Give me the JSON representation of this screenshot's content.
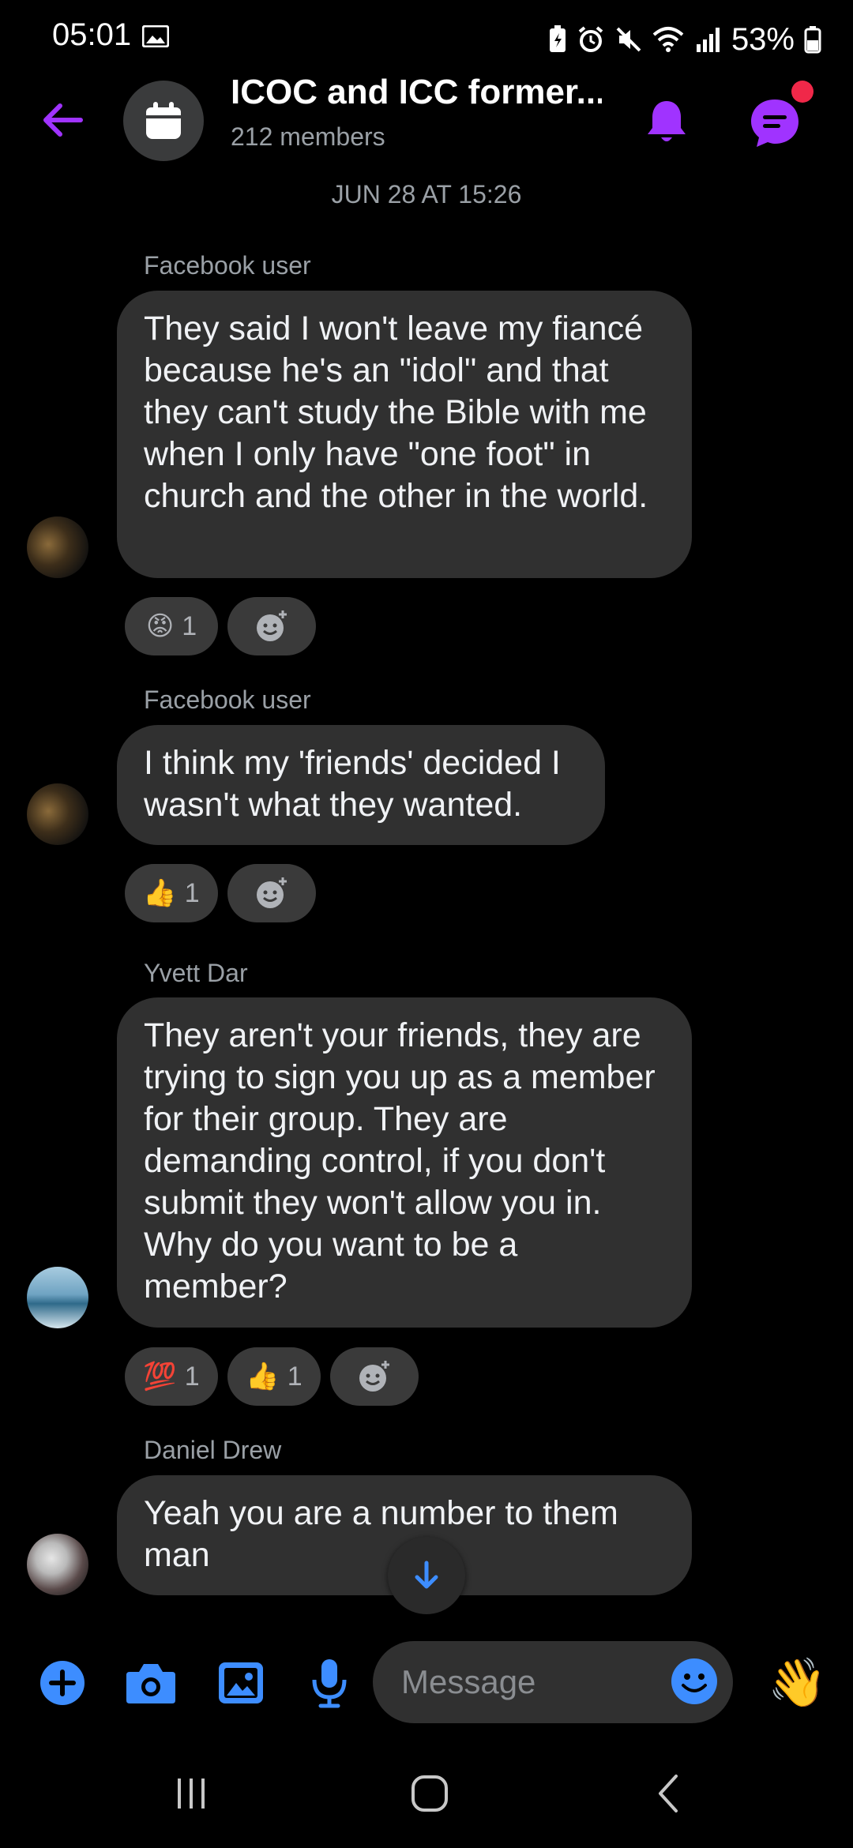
{
  "status_bar": {
    "time": "05:01",
    "battery": "53%"
  },
  "header": {
    "title": "ICOC and ICC former...",
    "subtitle": "212 members"
  },
  "date_separator": "JUN 28 AT 15:26",
  "messages": [
    {
      "sender": "Facebook user",
      "text": "They said I won't leave my fiancé because he's an \"idol\" and that they can't study the Bible with me when I only have \"one foot\" in church and the other in the world.",
      "reactions": [
        {
          "emoji": "😡",
          "count": "1"
        }
      ]
    },
    {
      "sender": "Facebook user",
      "text": "I think my 'friends' decided I wasn't what they wanted.",
      "reactions": [
        {
          "emoji": "👍",
          "count": "1"
        }
      ]
    },
    {
      "sender": "Yvett Dar",
      "text": "They aren't your friends, they are trying to sign you up as a member for their group. They are demanding control, if you don't submit they won't allow you in. Why do you want to be a member?",
      "reactions": [
        {
          "emoji": "💯",
          "count": "1"
        },
        {
          "emoji": "👍",
          "count": "1"
        }
      ]
    },
    {
      "sender": "Daniel Drew",
      "text": "Yeah you are a number to them man",
      "reactions": []
    }
  ],
  "composer": {
    "placeholder": "Message",
    "wave_emoji": "👋"
  },
  "colors": {
    "accent_purple": "#a033ff",
    "accent_blue": "#3d8dff",
    "bubble_bg": "#303030",
    "notification_dot": "#f02849"
  },
  "icons": [
    "back-arrow-icon",
    "calendar-icon",
    "bell-icon",
    "threads-icon",
    "add-reaction-icon",
    "arrow-down-icon",
    "plus-icon",
    "camera-icon",
    "gallery-icon",
    "mic-icon",
    "emoji-icon",
    "wave-icon",
    "recents-icon",
    "home-icon",
    "nav-back-icon"
  ]
}
